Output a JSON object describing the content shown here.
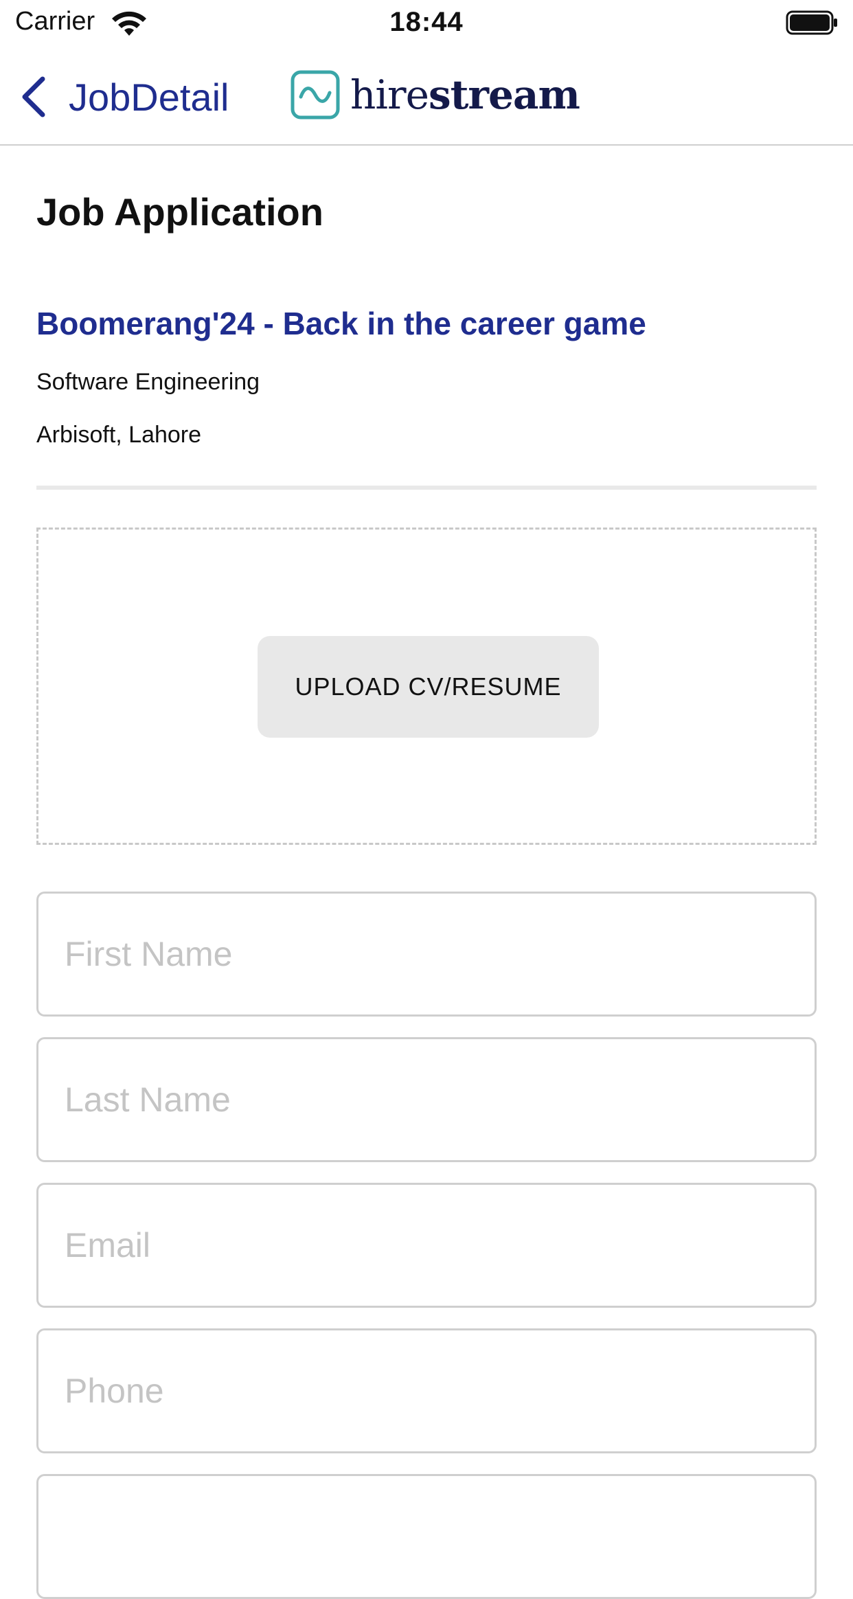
{
  "status_bar": {
    "carrier": "Carrier",
    "time": "18:44",
    "wifi_icon": "wifi-icon",
    "battery_icon": "battery-full-icon"
  },
  "nav": {
    "back_label": "JobDetail",
    "back_icon": "chevron-left-icon",
    "brand_prefix": "hire",
    "brand_suffix": "stream",
    "brand_logo": "wave-logo-icon",
    "accent_color": "#1f2d8f",
    "logo_color": "#3aa6a8"
  },
  "page": {
    "title": "Job Application"
  },
  "job": {
    "title": "Boomerang'24 - Back in the career game",
    "category": "Software Engineering",
    "location": "Arbisoft, Lahore"
  },
  "upload": {
    "button_label": "UPLOAD CV/RESUME"
  },
  "form": {
    "first_name": {
      "placeholder": "First Name",
      "value": ""
    },
    "last_name": {
      "placeholder": "Last Name",
      "value": ""
    },
    "email": {
      "placeholder": "Email",
      "value": ""
    },
    "phone": {
      "placeholder": "Phone",
      "value": ""
    },
    "next_field": {
      "placeholder": "",
      "value": ""
    }
  }
}
